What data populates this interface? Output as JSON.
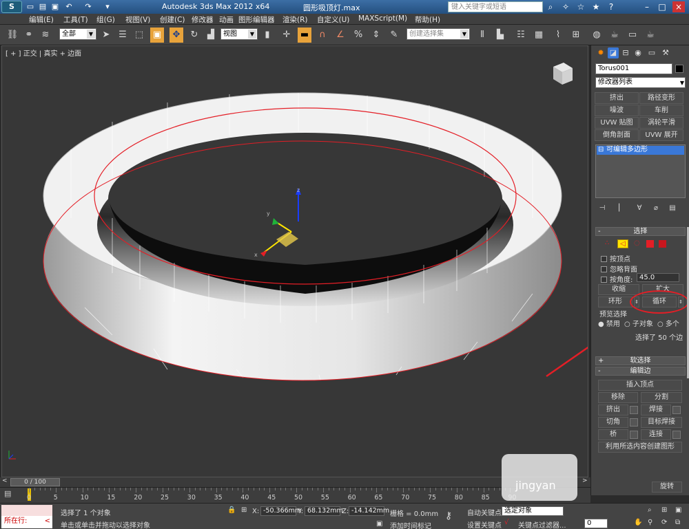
{
  "titlebar": {
    "app_title": "Autodesk 3ds Max  2012 x64",
    "file_name": "圆形吸顶灯.max",
    "search_placeholder": "键入关键字或短语",
    "logo": "S"
  },
  "menu": [
    "编辑(E)",
    "工具(T)",
    "组(G)",
    "视图(V)",
    "创建(C)",
    "修改器",
    "动画",
    "图形编辑器",
    "渲染(R)",
    "自定义(U)",
    "MAXScript(M)",
    "帮助(H)"
  ],
  "toolbar": {
    "selection_filter": "全部",
    "reference_coord": "视图",
    "named_selection": "创建选择集"
  },
  "viewport": {
    "label": "[ + ] 正交 | 真实 + 边面",
    "axis_x": "x",
    "axis_y": "y",
    "axis_z": "z"
  },
  "cmdpanel": {
    "object_name": "Torus001",
    "modifier_list": "修改器列表",
    "modifier_buttons": [
      "挤出",
      "路径变形",
      "噪波",
      "车削",
      "UVW 贴图",
      "涡轮平滑",
      "倒角剖面",
      "UVW 展开"
    ],
    "stack_item": "可编辑多边形",
    "selection": {
      "header": "选择",
      "by_vertex": "按顶点",
      "ignore_backfacing": "忽略背面",
      "by_angle": "按角度:",
      "angle_value": "45.0",
      "shrink": "收缩",
      "grow": "扩大",
      "ring": "环形",
      "loop": "循环",
      "preview_selection": "预览选择",
      "preview_off": "禁用",
      "preview_subobject": "子对象",
      "preview_multi": "多个",
      "selected_info": "选择了 50 个边"
    },
    "soft_selection": "软选择",
    "edit_edges": {
      "header": "编辑边",
      "insert_vertex": "插入顶点",
      "remove": "移除",
      "split": "分割",
      "extrude": "挤出",
      "weld": "焊接",
      "chamfer": "切角",
      "target_weld": "目标焊接",
      "bridge": "桥",
      "connect": "连接",
      "create_shape": "利用所选内容创建图形",
      "turn": "旋转"
    }
  },
  "timeline": {
    "frame": "0 / 100",
    "ticks": [
      "0",
      "5",
      "10",
      "15",
      "20",
      "25",
      "30",
      "35",
      "40",
      "45",
      "50",
      "55",
      "60",
      "65",
      "70",
      "75",
      "80",
      "85",
      "90"
    ]
  },
  "statusbar": {
    "script_label": "所在行:",
    "selected_objects": "选择了 1 个对象",
    "prompt": "单击或单击并拖动以选择对象",
    "x_label": "X:",
    "x_value": "-50.366mm",
    "y_label": "Y:",
    "y_value": "68.132mm",
    "z_label": "Z:",
    "z_value": "-14.142mm",
    "grid": "栅格 = 0.0mm",
    "add_time_tag": "添加时间标记",
    "auto_key": "自动关键点",
    "set_key": "设置关键点",
    "selected_dropdown": "选定对象",
    "key_filters": "关键点过滤器...",
    "frame_field": "0"
  },
  "colors": {
    "accent": "#e8a33b",
    "red": "#e41e26",
    "selected_blue": "#3a78d8"
  },
  "watermark": "jingyan"
}
